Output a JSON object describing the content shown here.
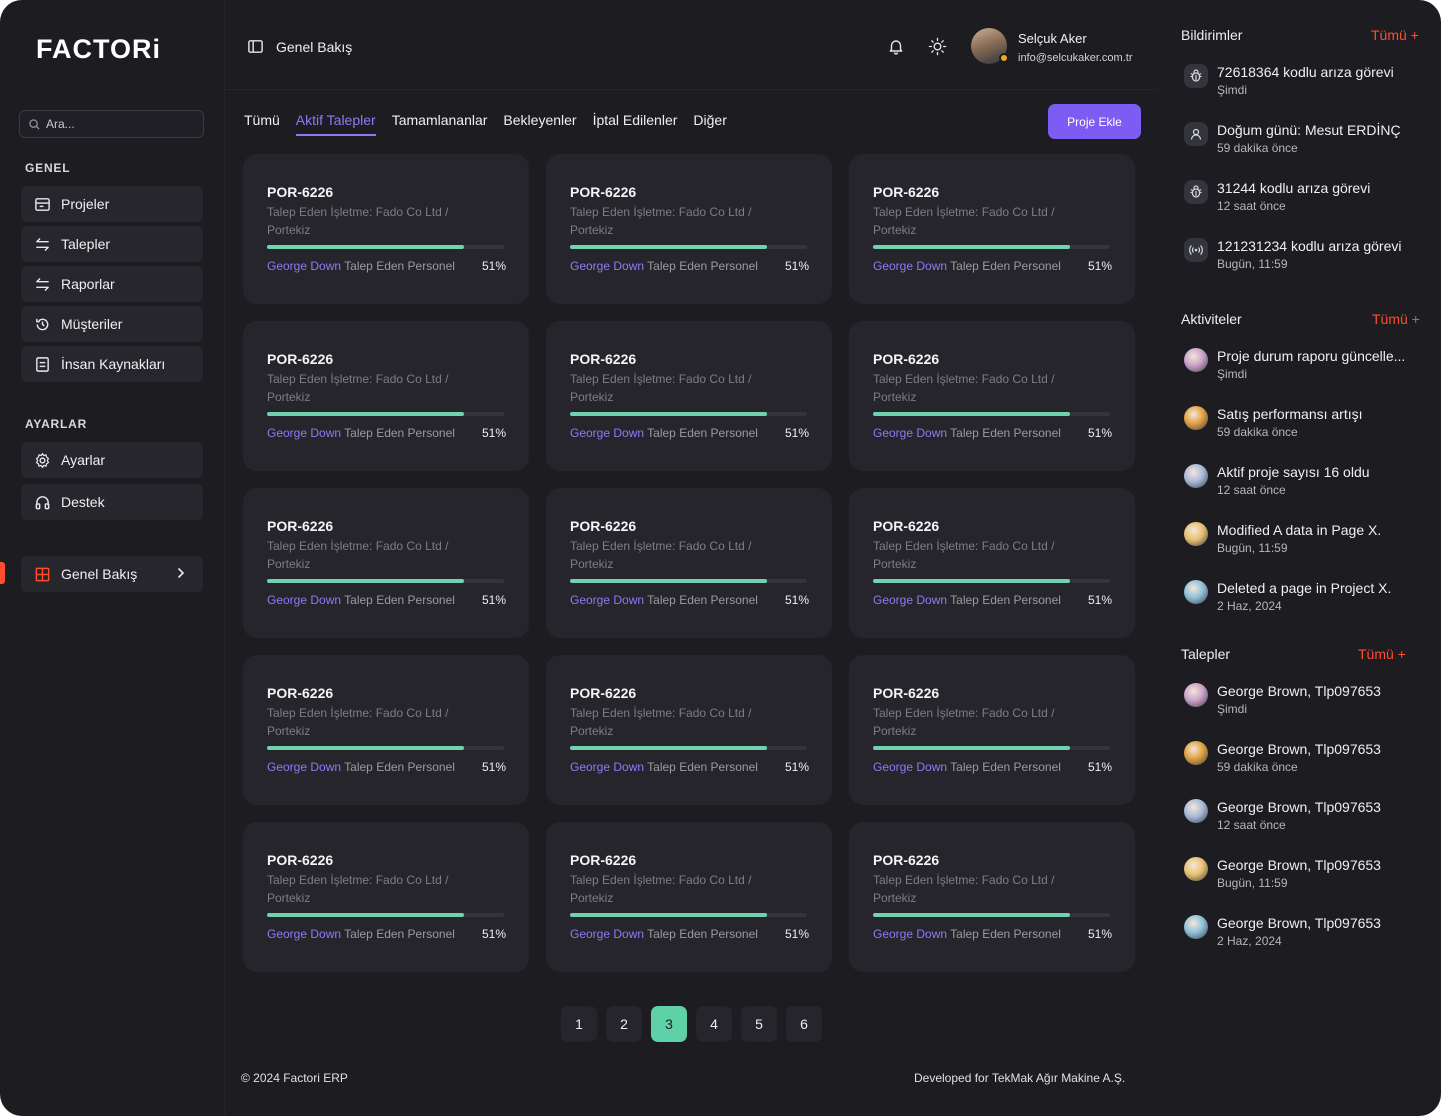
{
  "brand": {
    "logo_text": "FACTORi"
  },
  "search": {
    "placeholder": "Ara..."
  },
  "sidebar": {
    "section_general": "GENEL",
    "section_settings": "AYARLAR",
    "items": [
      {
        "label": "Projeler",
        "icon": "projects-icon"
      },
      {
        "label": "Talepler",
        "icon": "swap-icon"
      },
      {
        "label": "Raporlar",
        "icon": "swap-icon"
      },
      {
        "label": "Müşteriler",
        "icon": "history-icon"
      },
      {
        "label": "İnsan Kaynakları",
        "icon": "document-icon"
      }
    ],
    "settings_items": [
      {
        "label": "Ayarlar",
        "icon": "gear-icon"
      },
      {
        "label": "Destek",
        "icon": "headphones-icon"
      }
    ],
    "overview": {
      "label": "Genel Bakış",
      "icon": "grid-icon"
    }
  },
  "header": {
    "title": "Genel Bakış",
    "user_name": "Selçuk Aker",
    "user_email": "info@selcukaker.com.tr"
  },
  "tabs": [
    "Tümü",
    "Aktif Talepler",
    "Tamamlananlar",
    "Bekleyenler",
    "İptal Edilenler",
    "Diğer"
  ],
  "active_tab": "Aktif Talepler",
  "add_button": "Proje Ekle",
  "cards": [
    {
      "code": "POR-6226",
      "desc": "Talep Eden İşletme: Fado Co Ltd / Portekiz",
      "person": "George Down",
      "role": "Talep Eden Personel",
      "progress": "51%"
    },
    {
      "code": "POR-6226",
      "desc": "Talep Eden İşletme: Fado Co Ltd / Portekiz",
      "person": "George Down",
      "role": "Talep Eden Personel",
      "progress": "51%"
    },
    {
      "code": "POR-6226",
      "desc": "Talep Eden İşletme: Fado Co Ltd / Portekiz",
      "person": "George Down",
      "role": "Talep Eden Personel",
      "progress": "51%"
    },
    {
      "code": "POR-6226",
      "desc": "Talep Eden İşletme: Fado Co Ltd / Portekiz",
      "person": "George Down",
      "role": "Talep Eden Personel",
      "progress": "51%"
    },
    {
      "code": "POR-6226",
      "desc": "Talep Eden İşletme: Fado Co Ltd / Portekiz",
      "person": "George Down",
      "role": "Talep Eden Personel",
      "progress": "51%"
    },
    {
      "code": "POR-6226",
      "desc": "Talep Eden İşletme: Fado Co Ltd / Portekiz",
      "person": "George Down",
      "role": "Talep Eden Personel",
      "progress": "51%"
    },
    {
      "code": "POR-6226",
      "desc": "Talep Eden İşletme: Fado Co Ltd / Portekiz",
      "person": "George Down",
      "role": "Talep Eden Personel",
      "progress": "51%"
    },
    {
      "code": "POR-6226",
      "desc": "Talep Eden İşletme: Fado Co Ltd / Portekiz",
      "person": "George Down",
      "role": "Talep Eden Personel",
      "progress": "51%"
    },
    {
      "code": "POR-6226",
      "desc": "Talep Eden İşletme: Fado Co Ltd / Portekiz",
      "person": "George Down",
      "role": "Talep Eden Personel",
      "progress": "51%"
    },
    {
      "code": "POR-6226",
      "desc": "Talep Eden İşletme: Fado Co Ltd / Portekiz",
      "person": "George Down",
      "role": "Talep Eden Personel",
      "progress": "51%"
    },
    {
      "code": "POR-6226",
      "desc": "Talep Eden İşletme: Fado Co Ltd / Portekiz",
      "person": "George Down",
      "role": "Talep Eden Personel",
      "progress": "51%"
    },
    {
      "code": "POR-6226",
      "desc": "Talep Eden İşletme: Fado Co Ltd / Portekiz",
      "person": "George Down",
      "role": "Talep Eden Personel",
      "progress": "51%"
    },
    {
      "code": "POR-6226",
      "desc": "Talep Eden İşletme: Fado Co Ltd / Portekiz",
      "person": "George Down",
      "role": "Talep Eden Personel",
      "progress": "51%"
    },
    {
      "code": "POR-6226",
      "desc": "Talep Eden İşletme: Fado Co Ltd / Portekiz",
      "person": "George Down",
      "role": "Talep Eden Personel",
      "progress": "51%"
    },
    {
      "code": "POR-6226",
      "desc": "Talep Eden İşletme: Fado Co Ltd / Portekiz",
      "person": "George Down",
      "role": "Talep Eden Personel",
      "progress": "51%"
    }
  ],
  "card_fill_fraction": 0.83,
  "pagination": {
    "pages": [
      "1",
      "2",
      "3",
      "4",
      "5",
      "6"
    ],
    "active": "3"
  },
  "footer": {
    "left": "© 2024 Factori ERP",
    "right": "Developed for TekMak Ağır Makine A.Ş."
  },
  "notifications": {
    "title": "Bildirimler",
    "all_label": "Tümü +",
    "items": [
      {
        "text": "72618364 kodlu arıza görevi",
        "time": "Şimdi",
        "icon": "bug-icon"
      },
      {
        "text": "Doğum günü: Mesut ERDİNÇ",
        "time": "59 dakika önce",
        "icon": "user-icon"
      },
      {
        "text": "31244 kodlu arıza görevi",
        "time": "12 saat önce",
        "icon": "bug-icon"
      },
      {
        "text": "121231234 kodlu arıza görevi",
        "time": "Bugün, 11:59",
        "icon": "broadcast-icon"
      }
    ]
  },
  "activities": {
    "title": "Aktiviteler",
    "all_label": "Tümü +",
    "items": [
      {
        "text": "Proje durum raporu güncelle...",
        "time": "Şimdi",
        "color": "#c9a0c8"
      },
      {
        "text": "Satış performansı artışı",
        "time": "59 dakika önce",
        "color": "#e0a040"
      },
      {
        "text": "Aktif proje sayısı 16 oldu",
        "time": "12 saat önce",
        "color": "#a8b8d8"
      },
      {
        "text": "Modified A data in Page X.",
        "time": "Bugün, 11:59",
        "color": "#e8c070"
      },
      {
        "text": "Deleted a page in Project X.",
        "time": "2 Haz, 2024",
        "color": "#8cc0d8"
      }
    ]
  },
  "requests": {
    "title": "Talepler",
    "all_label": "Tümü +",
    "items": [
      {
        "text": "George Brown, Tlp097653",
        "time": "Şimdi",
        "color": "#c9a0c8"
      },
      {
        "text": "George Brown, Tlp097653",
        "time": "59 dakika önce",
        "color": "#e0a040"
      },
      {
        "text": "George Brown, Tlp097653",
        "time": "12 saat önce",
        "color": "#a8b8d8"
      },
      {
        "text": "George Brown, Tlp097653",
        "time": "Bugün, 11:59",
        "color": "#e8c070"
      },
      {
        "text": "George Brown, Tlp097653",
        "time": "2 Haz, 2024",
        "color": "#8cc0d8"
      }
    ]
  },
  "colors": {
    "accent": "#8b7cf6",
    "brand": "#ff4d2e",
    "progress": "#6fd3b0"
  }
}
